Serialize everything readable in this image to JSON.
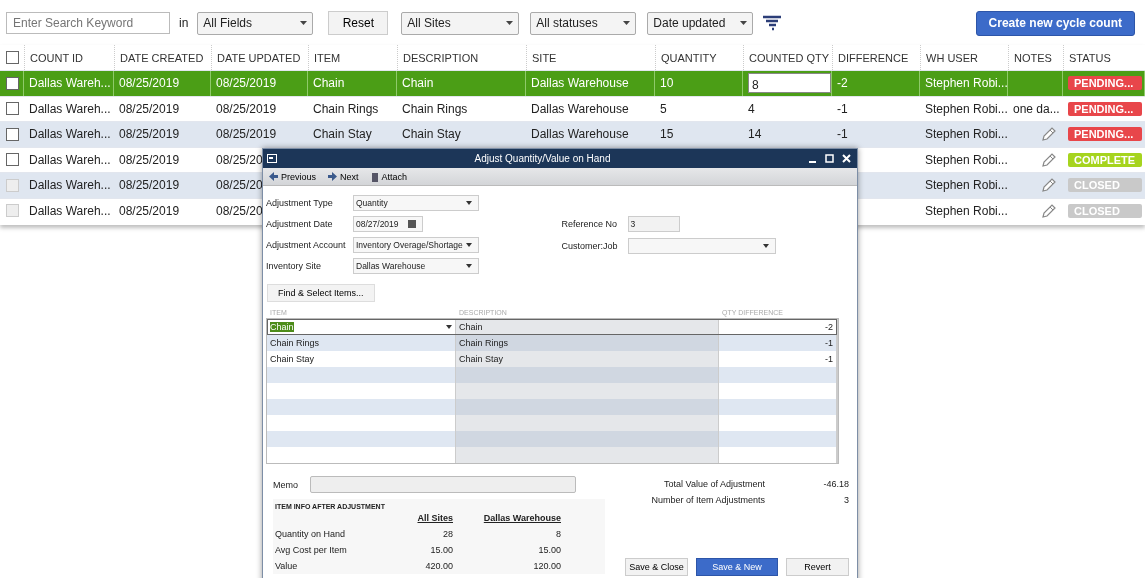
{
  "toolbar": {
    "search": {
      "placeholder": "Enter Search Keyword"
    },
    "in_label": "in",
    "field_filter": "All Fields",
    "reset": "Reset",
    "site_filter": "All Sites",
    "status_filter": "All statuses",
    "sort_by": "Date updated",
    "create_button": "Create new cycle count"
  },
  "table": {
    "select_all": {
      "checked": false
    },
    "columns": [
      "COUNT ID",
      "DATE CREATED",
      "DATE UPDATED",
      "ITEM",
      "DESCRIPTION",
      "SITE",
      "QUANTITY",
      "COUNTED QTY",
      "DIFFERENCE",
      "WH USER",
      "NOTES",
      "STATUS"
    ],
    "rows": [
      {
        "selected": true,
        "disabled": false,
        "count_id": "Dallas Wareh...",
        "date_created": "08/25/2019",
        "date_updated": "08/25/2019",
        "item": "Chain",
        "description": "Chain",
        "site": "Dallas Warehouse",
        "quantity": "10",
        "counted_qty": "8",
        "difference": "-2",
        "wh_user": "Stephen Robi...",
        "status": "PENDING...",
        "color": "#e8464a"
      },
      {
        "selected": false,
        "disabled": false,
        "count_id": "Dallas Wareh...",
        "date_created": "08/25/2019",
        "date_updated": "08/25/2019",
        "item": "Chain Rings",
        "description": "Chain Rings",
        "site": "Dallas Warehouse",
        "quantity": "5",
        "counted_qty": "4",
        "difference": "-1",
        "wh_user": "Stephen Robi...",
        "notes": {
          "kind": "text",
          "text": "one da..."
        },
        "status": "PENDING...",
        "color": "#e8464a"
      },
      {
        "selected": false,
        "disabled": false,
        "count_id": "Dallas Wareh...",
        "date_created": "08/25/2019",
        "date_updated": "08/25/2019",
        "item": "Chain Stay",
        "description": "Chain Stay",
        "site": "Dallas Warehouse",
        "quantity": "15",
        "counted_qty": "14",
        "difference": "-1",
        "wh_user": "Stephen Robi...",
        "notes": {
          "kind": "edit"
        },
        "status": "PENDING...",
        "color": "#e8464a"
      },
      {
        "selected": false,
        "disabled": false,
        "count_id": "Dallas Wareh...",
        "date_created": "08/25/2019",
        "date_updated": "08/25/20",
        "wh_user": "Stephen Robi...",
        "notes": {
          "kind": "edit"
        },
        "status": "COMPLETE",
        "color": "#a6d41e"
      },
      {
        "selected": false,
        "disabled": true,
        "count_id": "Dallas Wareh...",
        "date_created": "08/25/2019",
        "date_updated": "08/25/20",
        "wh_user": "Stephen Robi...",
        "notes": {
          "kind": "edit"
        },
        "status": "CLOSED",
        "color": "#c9c9c9"
      },
      {
        "selected": false,
        "disabled": true,
        "count_id": "Dallas Wareh...",
        "date_created": "08/25/2019",
        "date_updated": "08/25/20",
        "wh_user": "Stephen Robi...",
        "notes": {
          "kind": "edit"
        },
        "status": "CLOSED",
        "color": "#c9c9c9"
      }
    ]
  },
  "dialog": {
    "title": "Adjust Quantity/Value on Hand",
    "toolbar": [
      {
        "kind": "previous",
        "label": "Previous"
      },
      {
        "kind": "next",
        "label": "Next"
      },
      {
        "kind": "attach",
        "label": "Attach"
      }
    ],
    "left_fields": [
      {
        "kind": "dropdown",
        "label": "Adjustment Type",
        "value": "Quantity"
      },
      {
        "kind": "date",
        "label": "Adjustment Date",
        "value": "08/27/2019"
      },
      {
        "kind": "dropdown",
        "label": "Adjustment Account",
        "value": "Inventory Overage/Shortage"
      },
      {
        "kind": "dropdown",
        "label": "Inventory Site",
        "value": "Dallas Warehouse"
      }
    ],
    "right_fields": [
      {
        "kind": "text",
        "label": "Reference No",
        "value": "3"
      },
      {
        "kind": "dropdown",
        "label": "Customer:Job"
      }
    ],
    "find_button": "Find & Select Items...",
    "grid": {
      "columns": [
        "ITEM",
        "DESCRIPTION",
        "QTY DIFFERENCE"
      ],
      "rows": [
        {
          "selected": true,
          "item": "Chain",
          "description": "Chain",
          "qty": "-2"
        },
        {
          "selected": false,
          "item": "Chain Rings",
          "description": "Chain Rings",
          "qty": "-1"
        },
        {
          "selected": false,
          "item": "Chain Stay",
          "description": "Chain Stay",
          "qty": "-1"
        }
      ]
    },
    "memo_label": "Memo",
    "totals": [
      {
        "label": "Total Value of Adjustment",
        "value": "-46.18"
      },
      {
        "label": "Number of Item Adjustments",
        "value": "3"
      }
    ],
    "item_info": {
      "title": "ITEM INFO AFTER ADJUSTMENT",
      "columns": [
        "All Sites",
        "Dallas Warehouse"
      ],
      "rows": [
        {
          "label": "Quantity on Hand",
          "values": [
            "28",
            "8"
          ]
        },
        {
          "label": "Avg Cost per Item",
          "values": [
            "15.00",
            "15.00"
          ]
        },
        {
          "label": "Value",
          "values": [
            "420.00",
            "120.00"
          ]
        }
      ]
    },
    "buttons": [
      {
        "label": "Save & Close",
        "primary": false
      },
      {
        "label": "Save & New",
        "primary": true
      },
      {
        "label": "Revert",
        "primary": false
      }
    ]
  }
}
